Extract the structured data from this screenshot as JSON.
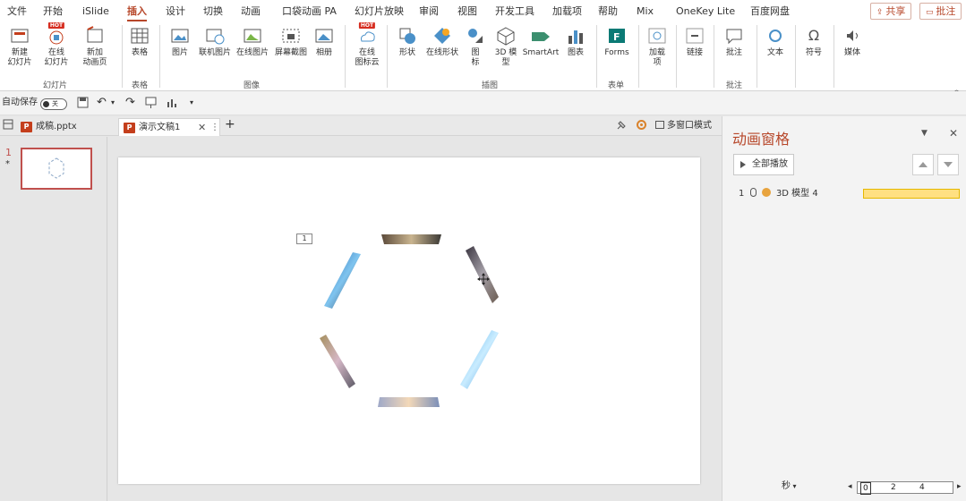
{
  "ribbon_tabs": [
    "文件",
    "开始",
    "iSlide",
    "插入",
    "设计",
    "切换",
    "动画",
    "口袋动画 PA",
    "幻灯片放映",
    "审阅",
    "视图",
    "开发工具",
    "加载项",
    "帮助",
    "Mix",
    "OneKey Lite",
    "百度网盘"
  ],
  "active_tab": "插入",
  "share_label": "共享",
  "comment_label": "批注",
  "ribbon": {
    "new_slide": "新建\n幻灯片",
    "online_slide": "在线\n幻灯片",
    "new_anim_page": "新加\n动画页",
    "group_slides": "幻灯片",
    "table": "表格",
    "group_table": "表格",
    "picture": "图片",
    "online_picture": "联机图片",
    "online_picture2": "在线图片",
    "screenshot": "屏幕截图",
    "album": "相册",
    "group_image": "图像",
    "online_icon_lib": "在线\n图标云",
    "shape": "形状",
    "online_shape": "在线形状",
    "icons": "图\n标",
    "model3d": "3D 模\n型",
    "smartart": "SmartArt",
    "chart": "图表",
    "group_illustrations": "插图",
    "forms": "Forms",
    "group_forms": "表单",
    "addins": "加载\n项",
    "link": "链接",
    "comment": "批注",
    "group_comment": "批注",
    "text": "文本",
    "symbol": "符号",
    "media": "媒体",
    "hot_badge": "HOT"
  },
  "qat": {
    "autosave": "自动保存",
    "autosave_state": "关"
  },
  "doc_tabs": [
    {
      "label": "成稿.pptx",
      "active": false
    },
    {
      "label": "演示文稿1",
      "active": true
    }
  ],
  "multi_window": "多窗口模式",
  "slide_number": "1",
  "slide_star": "*",
  "anim_tag": "1",
  "pane": {
    "title": "动画窗格",
    "play_all": "全部播放",
    "item_index": "1",
    "item_label": "3D 模型 4",
    "seconds": "秒",
    "ticks": [
      "0",
      "2",
      "4"
    ]
  },
  "colors": {
    "accent": "#b7472a",
    "timeline_bar": "#ffe082"
  }
}
